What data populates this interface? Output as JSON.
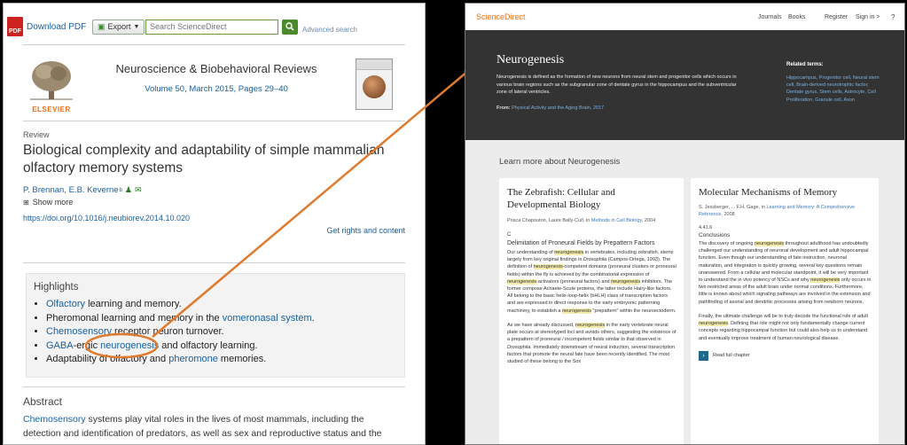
{
  "left": {
    "download_pdf": "Download PDF",
    "pdf_icon": "PDF",
    "export": "Export",
    "search_placeholder": "Search ScienceDirect",
    "advanced": "Advanced search",
    "logo_text": "ELSEVIER",
    "journal_title": "Neuroscience & Biobehavioral Reviews",
    "volume": "Volume 50, March 2015, Pages 29–40",
    "article_type": "Review",
    "title": "Biological complexity and adaptability of simple mammalian olfactory memory systems",
    "authors": "P. Brennan, E.B. Keverne",
    "author_sups": [
      "a",
      "b"
    ],
    "show_more": "Show more",
    "doi": "https://doi.org/10.1016/j.neubiorev.2014.10.020",
    "rights": "Get rights and content",
    "highlights_heading": "Highlights",
    "highlights": {
      "h1": {
        "link": "Olfactory",
        "text": " learning and memory."
      },
      "h2": {
        "pre": "Pheromonal learning and memory in the ",
        "link": "vomeronasal system",
        "post": "."
      },
      "h3": {
        "link": "Chemosensory",
        "text": " receptor neuron turnover."
      },
      "h4": {
        "link1": "GABA",
        "mid": "-ergic ",
        "link2": "neurogenesis",
        "post": " and olfactory learning."
      },
      "h5": {
        "pre": "Adaptability of olfactory and ",
        "link": "pheromone",
        "post": " memories."
      }
    },
    "abstract_heading": "Abstract",
    "abstract_link": "Chemosensory",
    "abstract_text": " systems play vital roles in the lives of most mammals, including the detection and identification of predators, as well as sex and reproductive status and the"
  },
  "right": {
    "brand": "ScienceDirect",
    "nav": [
      "Journals",
      "Books",
      "Register",
      "Sign in >"
    ],
    "topic": "Neurogenesis",
    "definition": "Neurogenesis is defined as the formation of new neurons from neural stem and progenitor cells which occurs in various brain regions such as the subgranular zone of dentate gyrus in the hippocampus and the subventricular zone of lateral ventricles.",
    "from_label": "From:",
    "from_source": "Physical Activity and the Aging Brain, 2017",
    "related_heading": "Related terms:",
    "related_terms": "Hippocampus, Progenitor cell, Neural stem cell, Brain-derived neurotrophic factor, Dentate gyrus, Stem cells, Astrocyte, Cell Proliferation, Granule cell, Axon",
    "learn_more": "Learn more about Neurogenesis",
    "card1": {
      "title": "The Zebrafish: Cellular and Developmental Biology",
      "authors": "Prisca Chapouton, Laure Bally-Cuif, in ",
      "source": "Methods in Cell Biology",
      "year": ", 2004",
      "section": "C",
      "subheading": "Delimitation of Proneural Fields by Prepattern Factors"
    },
    "card2": {
      "title": "Molecular Mechanisms of Memory",
      "authors": "S. Jessberger, ... F.H. Gage, in ",
      "source": "Learning and Memory: A Comprehensive Reference",
      "year": ", 2008",
      "section": "4.41.6",
      "subheading": "Conclusions",
      "read_more": "Read full chapter"
    }
  },
  "colors": {
    "link": "#1a5fa0",
    "highlight": "#f5f0b0",
    "arrow": "#e07a2e",
    "brand": "#e9711c",
    "hero": "#333333"
  }
}
